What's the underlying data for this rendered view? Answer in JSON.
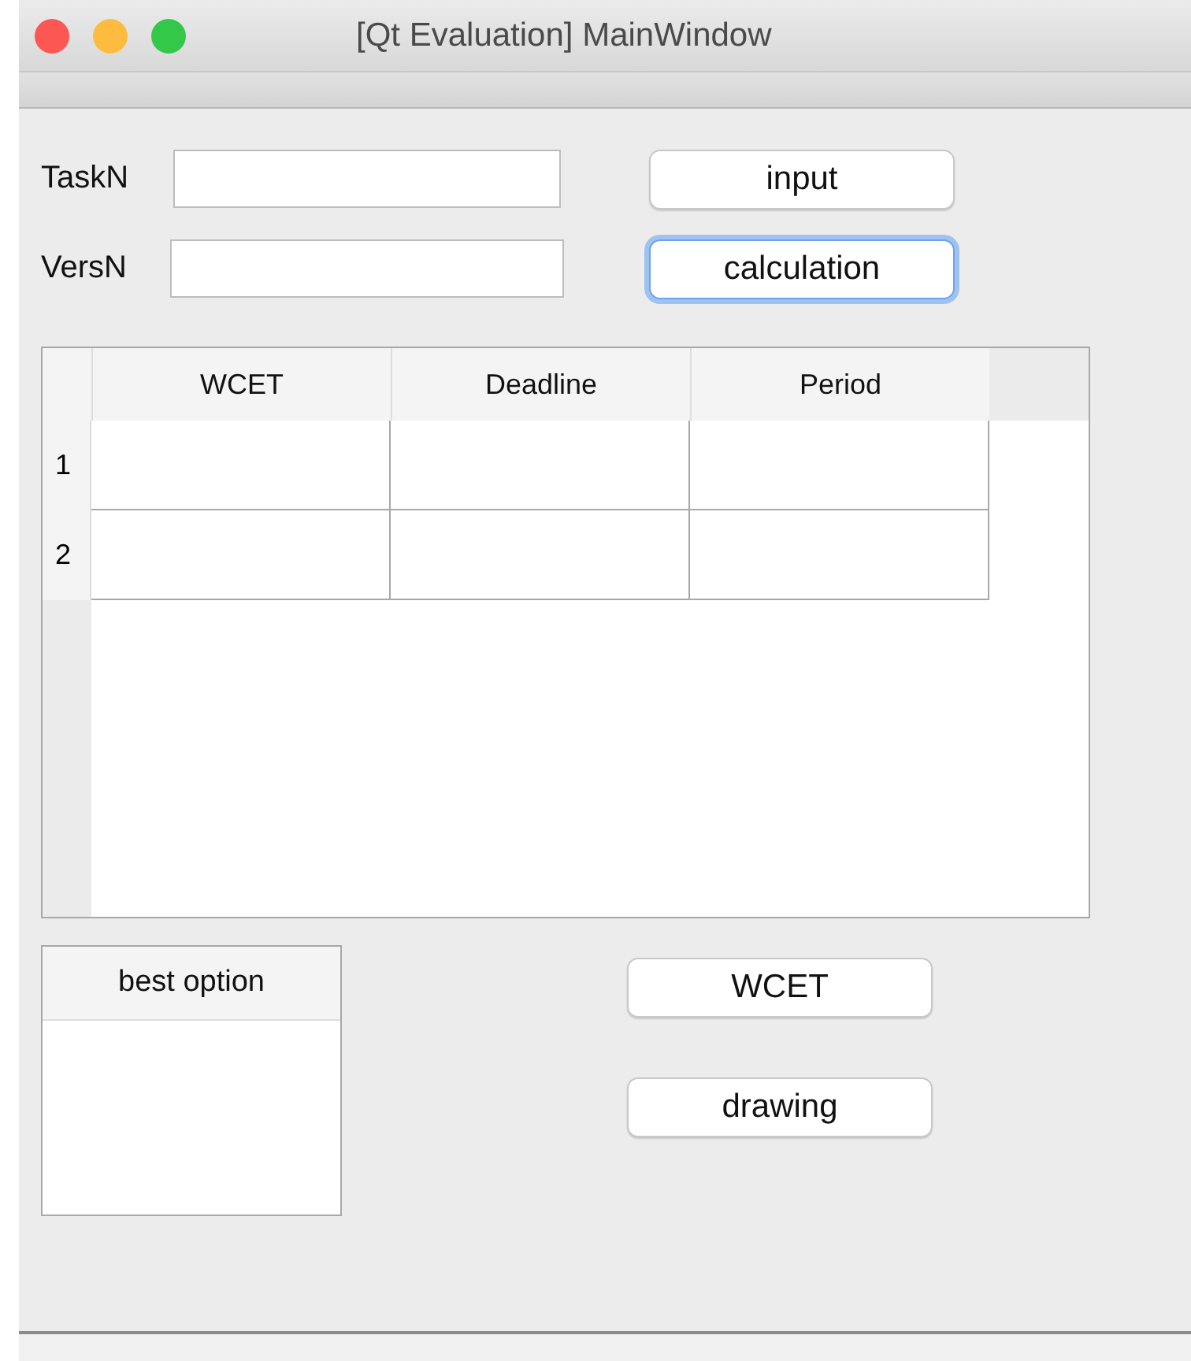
{
  "window": {
    "title": "[Qt Evaluation] MainWindow"
  },
  "fields": [
    {
      "label": "TaskN"
    },
    {
      "label": "VersN"
    }
  ],
  "top_buttons": [
    {
      "label": "input",
      "focused": false
    },
    {
      "label": "calculation",
      "focused": true
    }
  ],
  "table": {
    "columns": [
      "WCET",
      "Deadline",
      "Period"
    ],
    "rows": [
      {
        "header": "1"
      },
      {
        "header": "2"
      }
    ]
  },
  "best_option": {
    "header": "best option"
  },
  "bottom_buttons": [
    {
      "label": "WCET",
      "focused": false
    },
    {
      "label": "drawing",
      "focused": false
    }
  ]
}
